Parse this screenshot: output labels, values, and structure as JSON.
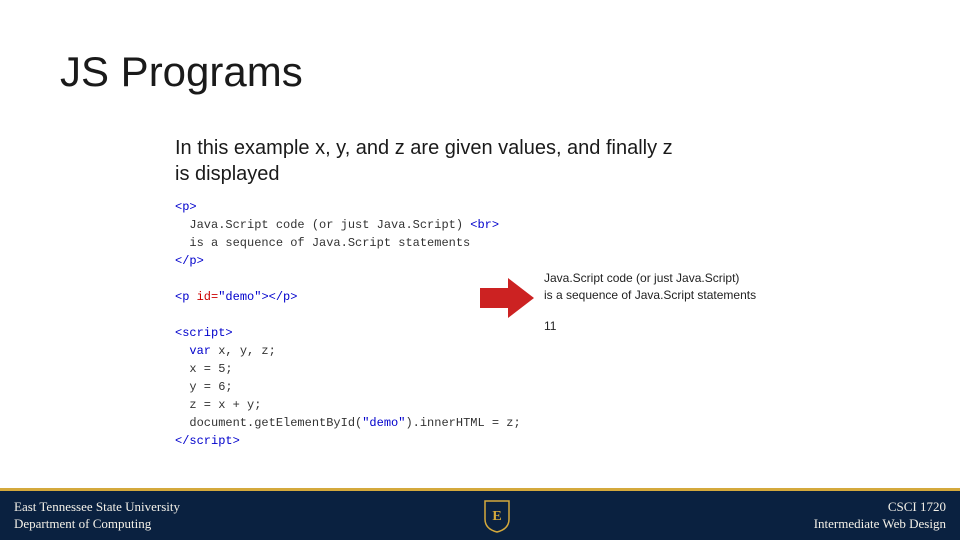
{
  "title": "JS Programs",
  "subtitle": "In this example x, y, and z are given values, and finally z is displayed",
  "code": {
    "l1_open": "<p>",
    "l2": "  Java.Script code (or just Java.Script) ",
    "l2_br": "<br>",
    "l3": "  is a sequence of Java.Script statements",
    "l4_close": "</p>",
    "l5_blank": "",
    "l6_open": "<p ",
    "l6_attr": "id=",
    "l6_val": "\"demo\"",
    "l6_close": "></p>",
    "l7_blank": "",
    "l8_open": "<script>",
    "l9_var": "  var",
    "l9_rest": " x, y, z;",
    "l10": "  x = 5;",
    "l11": "  y = 6;",
    "l12": "  z = x + y;",
    "l13a": "  document.getElementById(",
    "l13b": "\"demo\"",
    "l13c": ").innerHTML = z;",
    "l14_close": "</scr",
    "l14_close2": "ipt>"
  },
  "output": {
    "line1": "Java.Script code (or just Java.Script)",
    "line2": "is a sequence of Java.Script statements",
    "result": "11"
  },
  "footer": {
    "left_line1": "East Tennessee State University",
    "left_line2": "Department of Computing",
    "right_line1": "CSCI 1720",
    "right_line2": "Intermediate Web Design",
    "logo_letter": "E"
  }
}
